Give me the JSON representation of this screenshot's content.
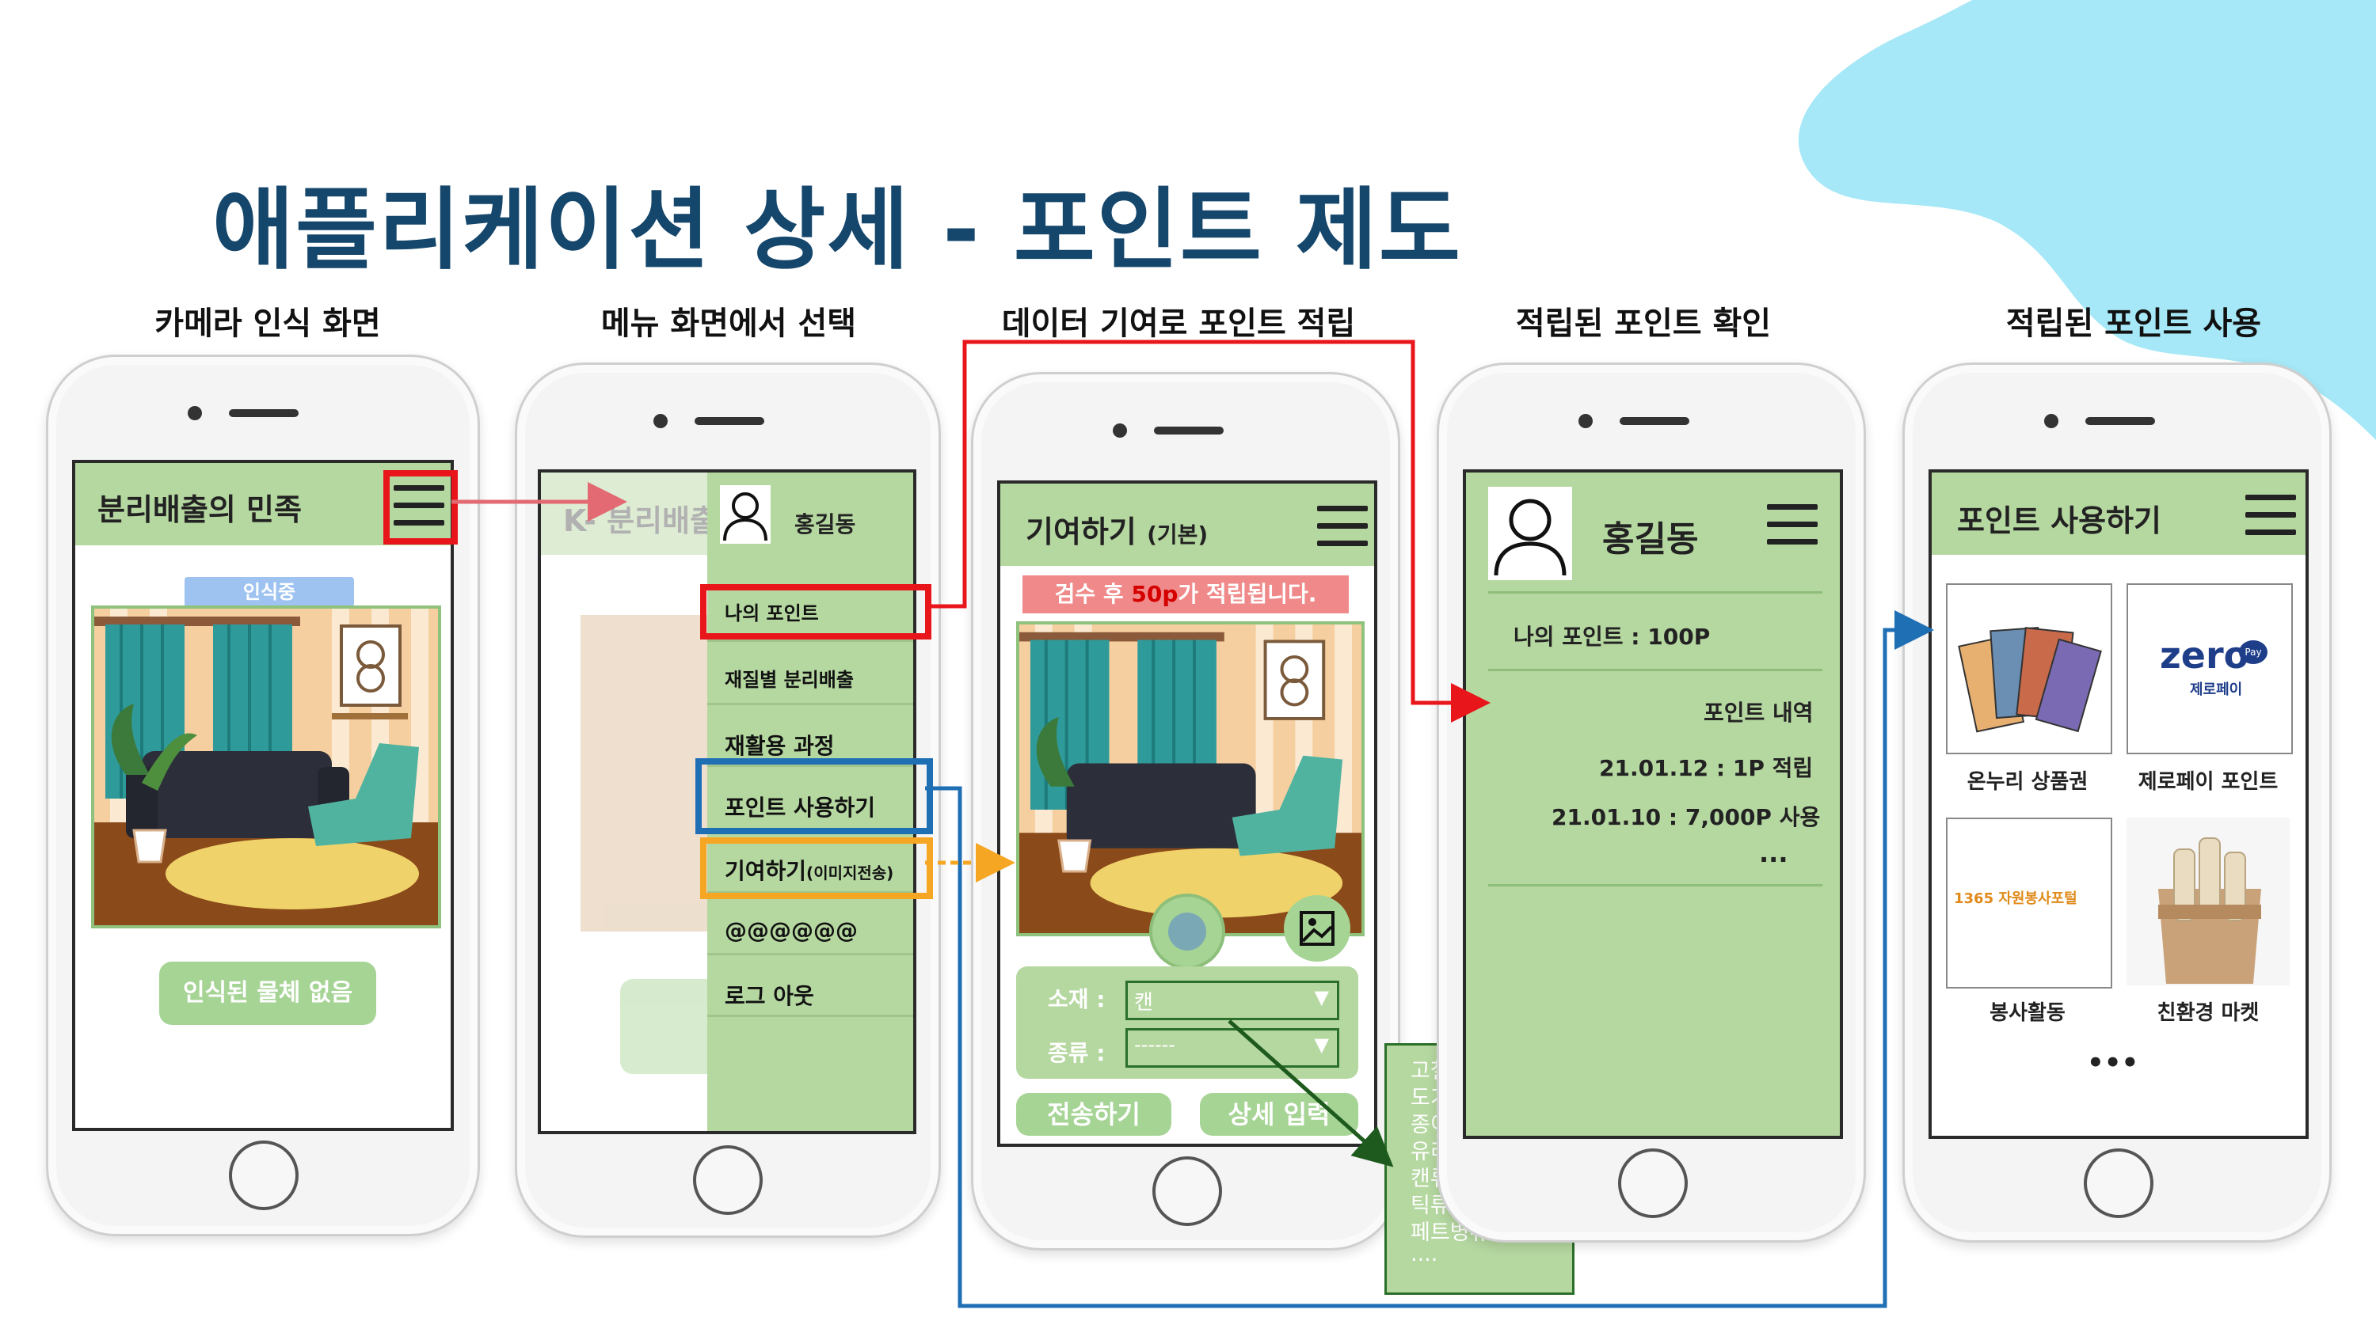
{
  "title": "애플리케이션 상세 -  포인트 제도",
  "captions": [
    "카메라 인식 화면",
    "메뉴 화면에서 선택",
    "데이터 기여로 포인트 적립",
    "적립된 포인트 확인",
    "적립된 포인트 사용"
  ],
  "phone1": {
    "header_title": "분리배출의 민족",
    "badge": "인식중",
    "status_button": "인식된 물체 없음"
  },
  "phone2": {
    "behind_title": "K- 분리배출",
    "behind_button": "@@\n@@",
    "user_name": "홍길동",
    "menu": [
      "나의 포인트",
      "재질별 분리배출",
      "재활용 과정",
      "포인트 사용하기",
      "기여하기",
      "@@@@@@",
      "로그 아웃"
    ],
    "menu_suffix": "(이미지전송)"
  },
  "phone3": {
    "header_title": "기여하기",
    "header_suffix": "(기본)",
    "banner_prefix": "검수 후 ",
    "banner_points": "50p",
    "banner_suffix": "가 적립됩니다.",
    "material_label": "소재 :",
    "material_value": "캔",
    "kind_label": "종류 :",
    "kind_value": "------",
    "send_button": "전송하기",
    "detail_button": "상세 입력",
    "dropdown_options": [
      "고철류",
      "도기류",
      "종이류",
      "유리병류",
      "캔류플라스",
      "틱류",
      "페트병류",
      "...."
    ]
  },
  "phone4": {
    "user_name": "홍길동",
    "my_points": "나의 포인트 : 100P",
    "history_title": "포인트 내역",
    "history": [
      "21.01.12 : 1P 적립",
      "21.01.10 : 7,000P 사용"
    ],
    "more": "..."
  },
  "phone5": {
    "header_title": "포인트 사용하기",
    "tiles": [
      "온누리 상품권",
      "제로페이 포인트",
      "봉사활동",
      "친환경 마켓"
    ],
    "zero_logo": "zero",
    "zero_pay": "Pay",
    "zero_sub": "제로페이",
    "volunteer_logo": "1365 자원봉사포털",
    "more": "•••"
  },
  "colors": {
    "title": "#15466b",
    "screen_green": "#b5d7a0",
    "highlight_red": "#e8161b",
    "highlight_blue": "#1f6fb5",
    "highlight_orange": "#f5a623",
    "blob": "#a6e8f7"
  }
}
